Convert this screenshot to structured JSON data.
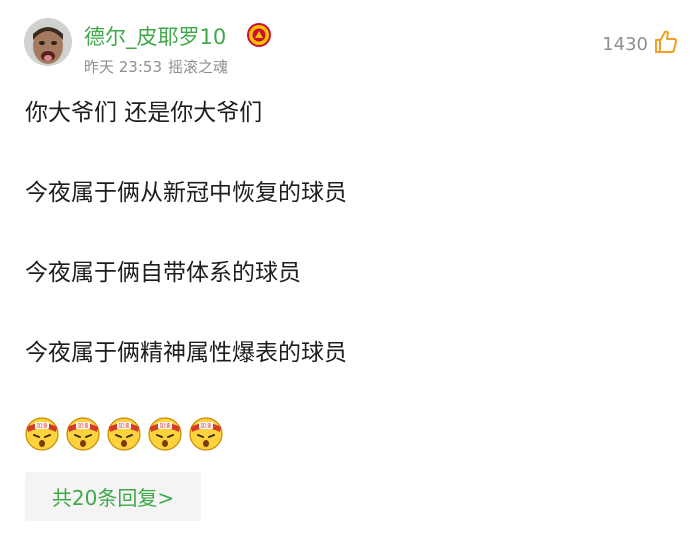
{
  "post": {
    "author": "德尔_皮耶罗10",
    "time": "昨天 23:53",
    "source": "摇滚之魂",
    "likes": "1430",
    "lines": [
      "你大爷们 还是你大爷们",
      "今夜属于俩从新冠中恢复的球员",
      "今夜属于俩自带体系的球员",
      "今夜属于俩精神属性爆表的球员"
    ],
    "emoji_count": 5,
    "emoji_label": "加油",
    "replies_label": "共20条回复>"
  },
  "icons": {
    "avatar": "avatar",
    "badge": "manchester-united-crest-icon",
    "like": "thumbs-up-icon",
    "emoji": "cheering-emoji-icon"
  },
  "colors": {
    "username": "#3fa94a",
    "meta": "#8f8f8f",
    "text": "#1e1e1e",
    "button_bg": "#f4f4f4"
  }
}
